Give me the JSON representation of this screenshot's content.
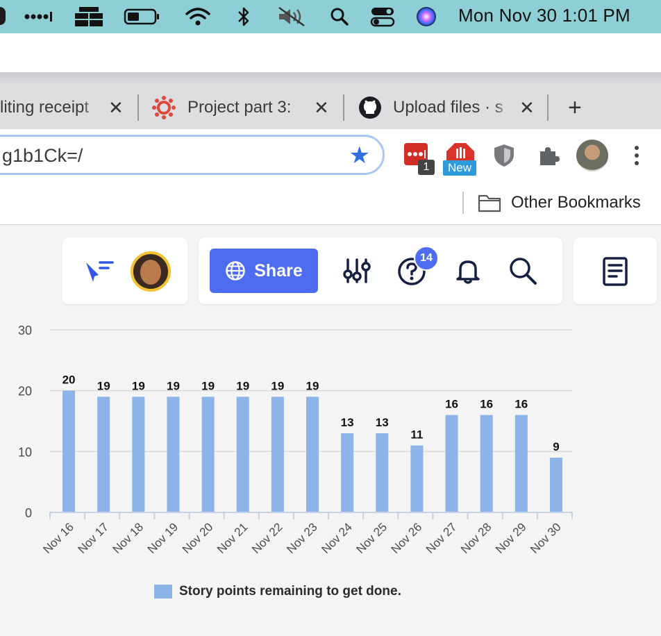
{
  "menubar": {
    "clock": "Mon Nov 30  1:01 PM",
    "icons": [
      "dots-signal-icon",
      "stack-icon",
      "battery-icon",
      "wifi-icon",
      "bluetooth-icon",
      "speaker-muted-icon",
      "search-icon",
      "control-center-icon",
      "siri-icon"
    ]
  },
  "tabs": [
    {
      "title": "liting receipt",
      "close": "✕"
    },
    {
      "title": "Project part 3:",
      "close": "✕"
    },
    {
      "title": "Upload files · s",
      "close": "✕"
    }
  ],
  "new_tab": "+",
  "omnibox": {
    "url": "g1b1Ck=/",
    "star": "★"
  },
  "extensions": {
    "badge_count": "1",
    "new_label": "New"
  },
  "bookmarks": {
    "other": "Other Bookmarks"
  },
  "app": {
    "share_label": "Share",
    "help_badge": "14"
  },
  "chart_data": {
    "type": "bar",
    "categories": [
      "Nov 16",
      "Nov 17",
      "Nov 18",
      "Nov 19",
      "Nov 20",
      "Nov 21",
      "Nov 22",
      "Nov 23",
      "Nov 24",
      "Nov 25",
      "Nov 26",
      "Nov 27",
      "Nov 28",
      "Nov 29",
      "Nov 30"
    ],
    "series": [
      {
        "name": "Story points remaining to get done.",
        "values": [
          20,
          19,
          19,
          19,
          19,
          19,
          19,
          19,
          13,
          13,
          11,
          16,
          16,
          16,
          9
        ]
      }
    ],
    "yticks": [
      "0",
      "10",
      "20",
      "30"
    ],
    "ylim": [
      0,
      30
    ],
    "grid": true,
    "legend": "bottom",
    "bar_color": "#8cb4e8"
  }
}
